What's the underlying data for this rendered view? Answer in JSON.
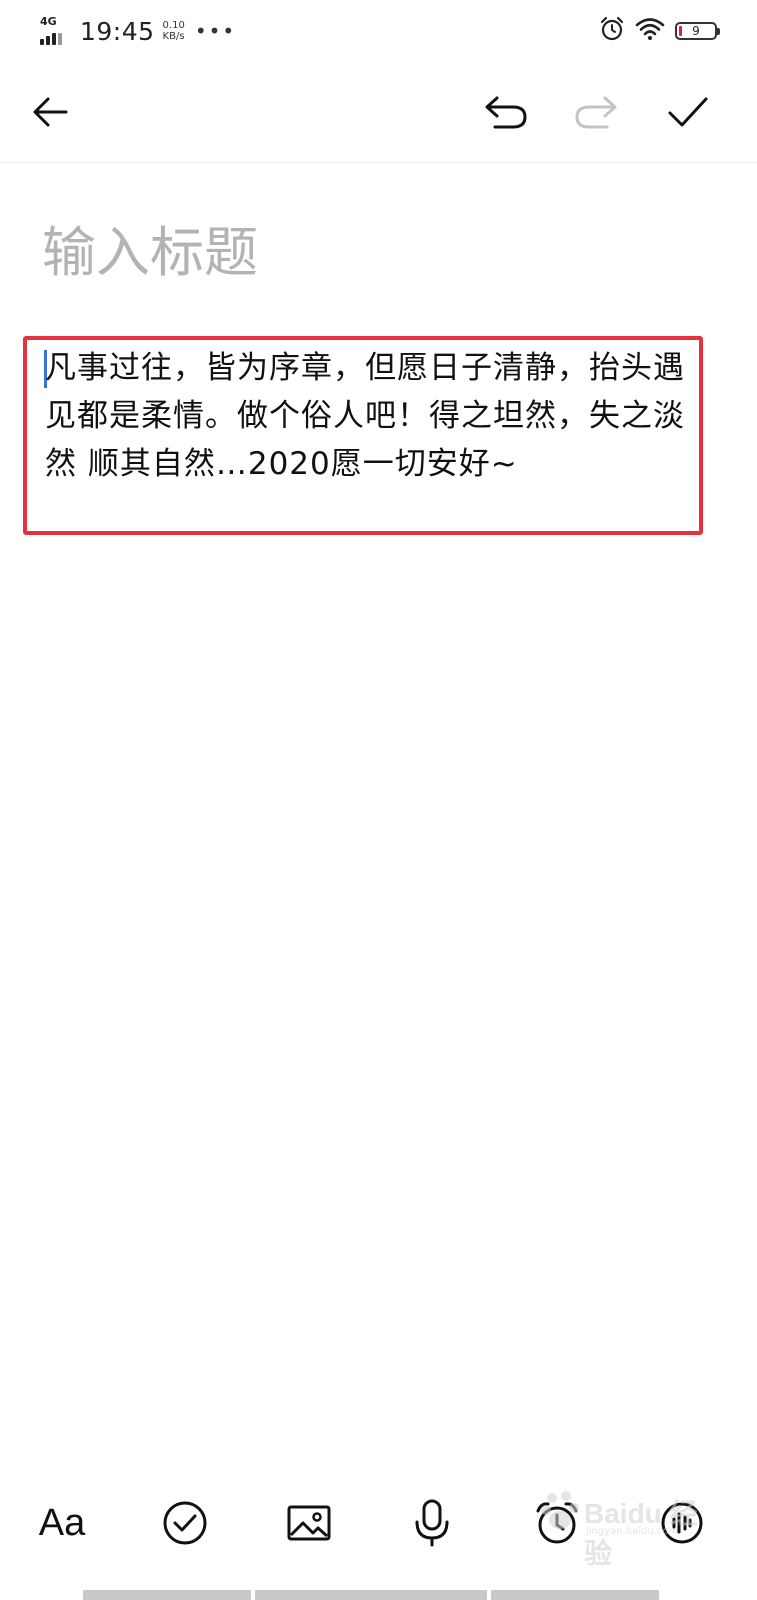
{
  "status_bar": {
    "network_type": "4G",
    "time": "19:45",
    "speed_value": "0.10",
    "speed_unit": "KB/s",
    "more": "•••",
    "battery_level": "9"
  },
  "toolbar": {
    "back_icon": "arrow-left-icon",
    "undo_icon": "undo-icon",
    "redo_icon": "redo-icon",
    "confirm_icon": "check-icon"
  },
  "note": {
    "title_placeholder": "输入标题",
    "title_value": "",
    "body": "凡事过往，皆为序章，但愿日子清静，抬头遇见都是柔情。做个俗人吧！得之坦然，失之淡然 顺其自然…2020愿一切安好~"
  },
  "bottom_bar": {
    "format_label": "Aa",
    "items": [
      "format-icon",
      "checklist-icon",
      "image-icon",
      "microphone-icon",
      "alarm-icon",
      "voice-note-icon"
    ]
  },
  "watermark": {
    "text": "Baidu 经验",
    "sub": "jingyan.baidu.com"
  },
  "colors": {
    "highlight_border": "#e6323e",
    "caret": "#3b6fd8",
    "placeholder": "#b3b3b3",
    "battery_low": "#e0222d"
  }
}
